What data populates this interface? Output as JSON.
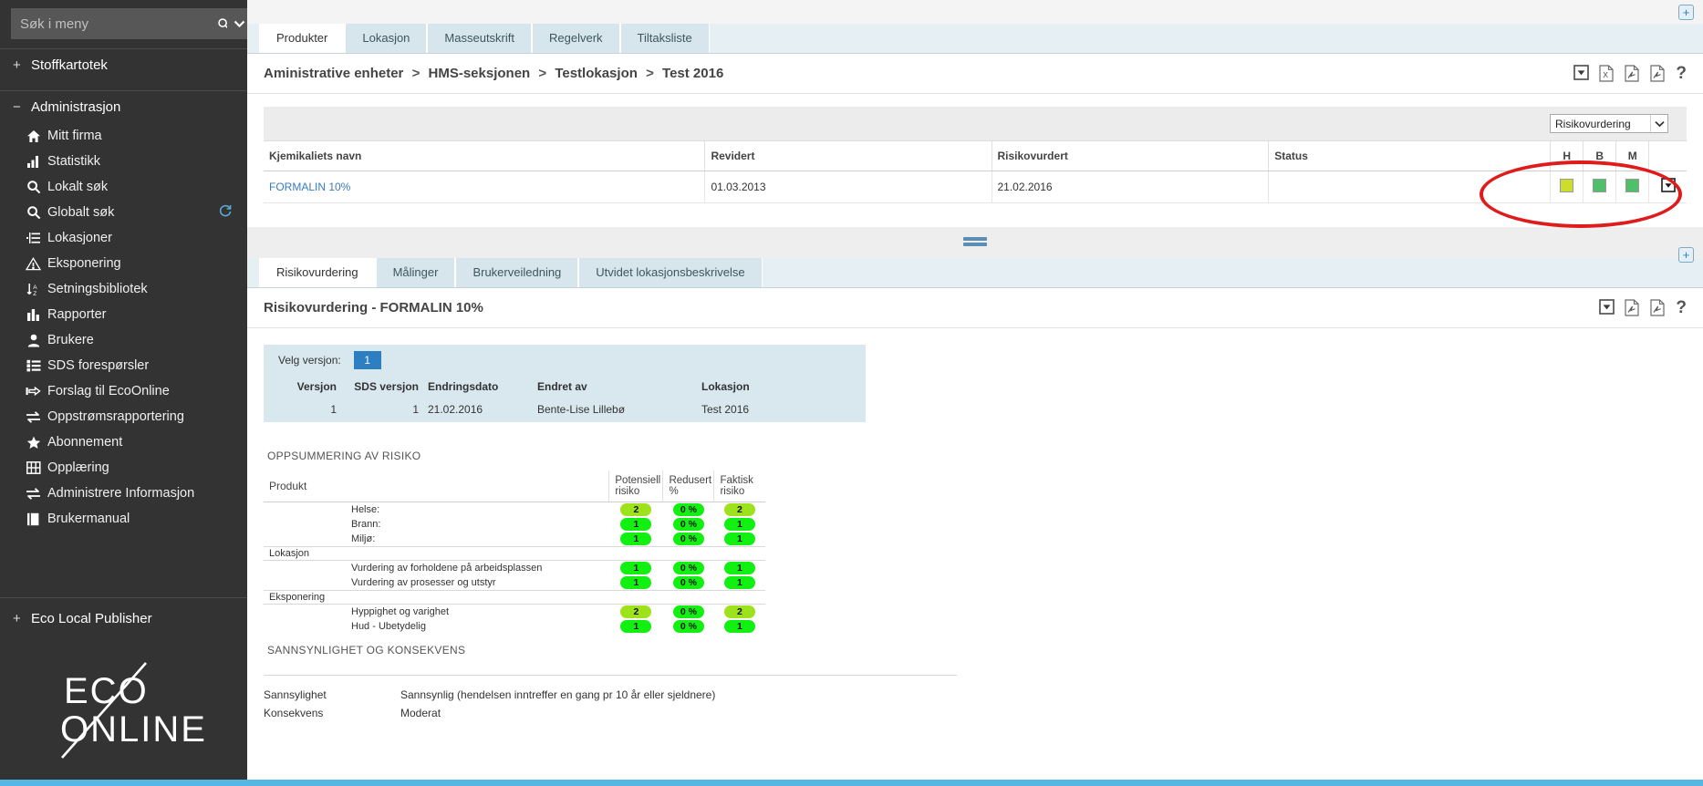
{
  "sidebar": {
    "search": {
      "placeholder": "Søk i meny",
      "value": "",
      "search_icon": "search-icon",
      "caret_icon": "chevron-down-icon"
    },
    "groups": [
      {
        "label": "Stoffkartotek",
        "toggle": "+",
        "expanded": false,
        "items": []
      },
      {
        "label": "Administrasjon",
        "toggle": "−",
        "expanded": true,
        "items": [
          {
            "label": "Mitt firma",
            "icon": "home-icon"
          },
          {
            "label": "Statistikk",
            "icon": "bar-chart-icon"
          },
          {
            "label": "Lokalt søk",
            "icon": "search-icon"
          },
          {
            "label": "Globalt søk",
            "icon": "search-icon",
            "badge_icon": "refresh-icon"
          },
          {
            "label": "Lokasjoner",
            "icon": "tree-list-icon"
          },
          {
            "label": "Eksponering",
            "icon": "warning-triangle-icon"
          },
          {
            "label": "Setningsbibliotek",
            "icon": "sort-az-icon"
          },
          {
            "label": "Rapporter",
            "icon": "bar-chart-icon"
          },
          {
            "label": "Brukere",
            "icon": "user-icon"
          },
          {
            "label": "SDS forespørsler",
            "icon": "list-icon"
          },
          {
            "label": "Forslag til EcoOnline",
            "icon": "pointing-hand-icon"
          },
          {
            "label": "Oppstrømsrapportering",
            "icon": "exchange-arrows-icon"
          },
          {
            "label": "Abonnement",
            "icon": "star-icon"
          },
          {
            "label": "Opplæring",
            "icon": "film-icon"
          },
          {
            "label": "Administrere Informasjon",
            "icon": "exchange-arrows-icon"
          },
          {
            "label": "Brukermanual",
            "icon": "book-icon"
          }
        ]
      },
      {
        "label": "Eco Local Publisher",
        "toggle": "+",
        "expanded": false,
        "items": []
      }
    ],
    "logo": {
      "line1": "ECO",
      "line2": "ONLINE"
    }
  },
  "top_panel": {
    "expand_icon": "plus-expand-icon",
    "tabs": [
      {
        "label": "Produkter",
        "active": true
      },
      {
        "label": "Lokasjon",
        "active": false
      },
      {
        "label": "Masseutskrift",
        "active": false
      },
      {
        "label": "Regelverk",
        "active": false
      },
      {
        "label": "Tiltaksliste",
        "active": false
      }
    ],
    "breadcrumb": [
      "Aministrative enheter",
      "HMS-seksjonen",
      "Testlokasjon",
      "Test 2016"
    ],
    "breadcrumb_separator": ">",
    "toolbar": [
      {
        "name": "dropdown-export-icon",
        "glyph": "▼"
      },
      {
        "name": "excel-export-icon",
        "glyph": "X"
      },
      {
        "name": "pdf-export-icon",
        "glyph": "PDF"
      },
      {
        "name": "pdf-export-alt-icon",
        "glyph": "PDF"
      },
      {
        "name": "help-icon",
        "glyph": "?"
      }
    ],
    "filter_select": {
      "value": "Risikovurdering",
      "caret_icon": "chevron-down-icon"
    },
    "table": {
      "columns": [
        "Kjemikaliets navn",
        "Revidert",
        "Risikovurdert",
        "Status"
      ],
      "risk_columns": [
        "H",
        "B",
        "M"
      ],
      "rows": [
        {
          "name": "FORMALIN 10%",
          "revidert": "01.03.2013",
          "risikovurdert": "21.02.2016",
          "status": "",
          "risk_colors": [
            "#cddd2e",
            "#4fbf6a",
            "#4fbf6a"
          ],
          "row_menu_icon": "dropdown-menu-icon"
        }
      ]
    },
    "annotation": {
      "type": "red-oval-highlight",
      "color": "#e01b1b"
    }
  },
  "splitter": {
    "name": "panel-splitter-handle"
  },
  "bottom_panel": {
    "expand_icon": "plus-expand-icon",
    "tabs": [
      {
        "label": "Risikovurdering",
        "active": true
      },
      {
        "label": "Målinger",
        "active": false
      },
      {
        "label": "Brukerveiledning",
        "active": false
      },
      {
        "label": "Utvidet lokasjonsbeskrivelse",
        "active": false
      }
    ],
    "title": "Risikovurdering - FORMALIN 10%",
    "toolbar": [
      {
        "name": "dropdown-export-icon",
        "glyph": "▼"
      },
      {
        "name": "pdf-export-icon",
        "glyph": "PDF"
      },
      {
        "name": "pdf-export-alt-icon",
        "glyph": "PDF"
      },
      {
        "name": "help-icon",
        "glyph": "?"
      }
    ],
    "version_bar": {
      "label": "Velg versjon:",
      "selected": "1"
    },
    "version_table": {
      "columns": [
        "Versjon",
        "SDS versjon",
        "Endringsdato",
        "Endret av",
        "Lokasjon"
      ],
      "rows": [
        {
          "versjon": "1",
          "sds_versjon": "1",
          "endringsdato": "21.02.2016",
          "endret_av": "Bente-Lise Lillebø",
          "lokasjon": "Test 2016"
        }
      ]
    },
    "risk_summary": {
      "section_title": "OPPSUMMERING AV RISIKO",
      "col_product": "Produkt",
      "columns": [
        "Potensiell risiko",
        "Redusert %",
        "Faktisk risiko"
      ],
      "groups": [
        {
          "group": "",
          "rows": [
            {
              "label": "Helse:",
              "potensiell": "2",
              "potensiell_color": "b-yellow",
              "redusert": "0 %",
              "redusert_color": "b-green",
              "faktisk": "2",
              "faktisk_color": "b-yellow"
            },
            {
              "label": "Brann:",
              "potensiell": "1",
              "potensiell_color": "b-green",
              "redusert": "0 %",
              "redusert_color": "b-green",
              "faktisk": "1",
              "faktisk_color": "b-green"
            },
            {
              "label": "Miljø:",
              "potensiell": "1",
              "potensiell_color": "b-green",
              "redusert": "0 %",
              "redusert_color": "b-green",
              "faktisk": "1",
              "faktisk_color": "b-green"
            }
          ]
        },
        {
          "group": "Lokasjon",
          "rows": [
            {
              "label": "Vurdering av forholdene på arbeidsplassen",
              "potensiell": "1",
              "potensiell_color": "b-green",
              "redusert": "0 %",
              "redusert_color": "b-green",
              "faktisk": "1",
              "faktisk_color": "b-green"
            },
            {
              "label": "Vurdering av prosesser og utstyr",
              "potensiell": "1",
              "potensiell_color": "b-green",
              "redusert": "0 %",
              "redusert_color": "b-green",
              "faktisk": "1",
              "faktisk_color": "b-green"
            }
          ]
        },
        {
          "group": "Eksponering",
          "rows": [
            {
              "label": "Hyppighet og varighet",
              "potensiell": "2",
              "potensiell_color": "b-yellow",
              "redusert": "0 %",
              "redusert_color": "b-green",
              "faktisk": "2",
              "faktisk_color": "b-yellow"
            },
            {
              "label": "Hud - Ubetydelig",
              "potensiell": "1",
              "potensiell_color": "b-green",
              "redusert": "0 %",
              "redusert_color": "b-green",
              "faktisk": "1",
              "faktisk_color": "b-green"
            }
          ]
        }
      ]
    },
    "likelihood": {
      "section_title": "SANNSYNLIGHET OG KONSEKVENS",
      "rows": [
        {
          "key": "Sannsylighet",
          "value": "Sannsynlig (hendelsen inntreffer en gang pr 10 år eller sjeldnere)"
        },
        {
          "key": "Konsekvens",
          "value": "Moderat"
        }
      ]
    }
  }
}
